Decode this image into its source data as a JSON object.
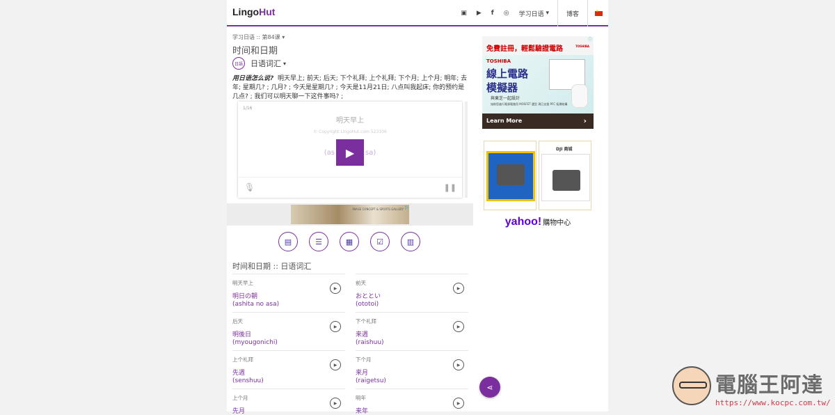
{
  "header": {
    "logo_main": "Lingo",
    "logo_accent": "Hut",
    "nav": {
      "icons": [
        "video-icon",
        "youtube-icon",
        "facebook-icon",
        "instagram-icon"
      ],
      "language_menu": "学习日语",
      "blog": "博客",
      "flag": "china-flag-icon"
    },
    "accent_color": "#7b2f9e"
  },
  "lesson": {
    "breadcrumb_prefix": "学习日语 ::",
    "breadcrumb_lesson": "第84课",
    "title": "时间和日期",
    "category_badge": "日語",
    "category": "日语词汇",
    "intro_bold": "用日语怎么说?",
    "intro_text": "明天早上; 前天; 后天; 下个礼拜; 上个礼拜; 下个月; 上个月; 明年; 去年; 星期几? ; 几月? ; 今天是星期几? ; 今天是11月21日; 八点叫我起床; 你的预约是几点? ; 我们可以明天聊一下这件事吗? ;"
  },
  "player": {
    "count": "1/16",
    "word": "明天早上",
    "copyright": "© Copyright LingoHut.com 523106",
    "reading_left": "(as",
    "reading_right": "sa)"
  },
  "ad_strip": {
    "text": "IMAGE CONCEPT & SPORTS GALLERY"
  },
  "section_title": "时间和日期 :: 日语词汇",
  "vocab": [
    {
      "label": "明天早上",
      "word": "明日の朝",
      "reading": "(ashita no asa)"
    },
    {
      "label": "前天",
      "word": "おととい",
      "reading": "(ototoi)"
    },
    {
      "label": "后天",
      "word": "明後日",
      "reading": "(myougonichi)"
    },
    {
      "label": "下个礼拜",
      "word": "来週",
      "reading": "(raishuu)"
    },
    {
      "label": "上个礼拜",
      "word": "先週",
      "reading": "(senshuu)"
    },
    {
      "label": "下个月",
      "word": "来月",
      "reading": "(raigetsu)"
    },
    {
      "label": "上个月",
      "word": "先月",
      "reading": ""
    },
    {
      "label": "明年",
      "word": "来年",
      "reading": ""
    }
  ],
  "ad_toshiba": {
    "headline": "免費註冊，輕鬆驗證電路",
    "brand_small": "TOSHIBA",
    "brand": "TOSHIBA",
    "big1": "線上電路",
    "big2": "模擬器",
    "sub": "與東芝一起設計",
    "small": "協助您進行電源電路用 MOSFET 選型 現已支援 PFC 拓撲結構",
    "cta": "Learn More"
  },
  "ad_yahoo": {
    "brand_dji": "DJI 商城",
    "yahoo": "yahoo!",
    "shop": "購物中心"
  },
  "watermark": {
    "brand": "電腦王阿達",
    "url": "https://www.kocpc.com.tw/"
  }
}
